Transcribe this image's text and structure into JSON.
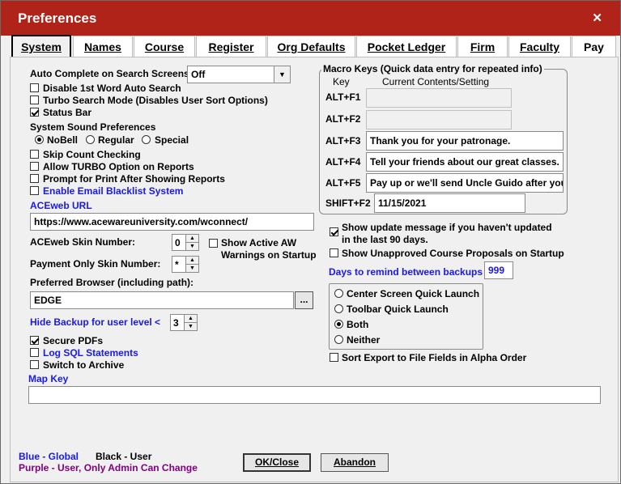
{
  "window": {
    "title": "Preferences",
    "close_label": "✕"
  },
  "tabs": [
    "System",
    "Names",
    "Course",
    "Register",
    "Org Defaults",
    "Pocket Ledger",
    "Firm",
    "Faculty",
    "Pay"
  ],
  "system": {
    "auto_complete_label": "Auto Complete on Search Screens:",
    "auto_complete_value": "Off",
    "disable_first_word": "Disable 1st Word Auto Search",
    "turbo_search": "Turbo Search Mode (Disables User Sort Options)",
    "status_bar": "Status Bar",
    "sound_label": "System Sound Preferences",
    "sound_options": [
      "NoBell",
      "Regular",
      "Special"
    ],
    "sound_selected": "NoBell",
    "skip_count": "Skip Count Checking",
    "allow_turbo": "Allow TURBO Option on Reports",
    "prompt_print": "Prompt for Print After Showing Reports",
    "enable_blacklist": "Enable Email Blacklist System",
    "aceweb_url_label": "ACEweb URL",
    "aceweb_url_value": "https://www.acewareuniversity.com/wconnect/",
    "skin_number_label": "ACEweb Skin Number:",
    "skin_number_value": "0",
    "show_active_warnings_1": "Show Active AW",
    "show_active_warnings_2": "Warnings on Startup",
    "payment_skin_label": "Payment Only Skin Number:",
    "payment_skin_value": "*",
    "browser_label": "Preferred Browser (including path):",
    "browser_value": "EDGE",
    "browse_button": "...",
    "hide_backup_label": "Hide Backup for user level <",
    "hide_backup_value": "3",
    "secure_pdfs": "Secure PDFs",
    "log_sql": "Log SQL Statements",
    "switch_archive": "Switch to Archive",
    "map_key_label": "Map Key",
    "map_key_value": ""
  },
  "macro": {
    "title": "Macro Keys (Quick data entry for repeated info)",
    "col_key": "Key",
    "col_contents": "Current Contents/Setting",
    "rows": [
      {
        "key": "ALT+F1",
        "value": "",
        "disabled": true
      },
      {
        "key": "ALT+F2",
        "value": "",
        "disabled": true
      },
      {
        "key": "ALT+F3",
        "value": "Thank you for your patronage.",
        "disabled": false
      },
      {
        "key": "ALT+F4",
        "value": "Tell your friends about our great classes.",
        "disabled": false
      },
      {
        "key": "ALT+F5",
        "value": "Pay up or we'll send Uncle Guido after you!",
        "disabled": false
      },
      {
        "key": "SHIFT+F2",
        "value": "11/15/2021",
        "disabled": false
      }
    ]
  },
  "right": {
    "show_update_1": "Show update message if you haven't updated",
    "show_update_2": "in the last 90 days.",
    "show_unapproved": "Show Unapproved Course Proposals on Startup",
    "days_backup_label": "Days to remind between backups",
    "days_backup_value": "999",
    "quick_launch_options": [
      "Center Screen Quick Launch",
      "Toolbar Quick Launch",
      "Both",
      "Neither"
    ],
    "quick_launch_selected": "Both",
    "sort_export": "Sort Export to File Fields in Alpha Order"
  },
  "legend": {
    "blue": "Blue - Global",
    "black": "Black - User",
    "purple": "Purple - User, Only Admin Can Change"
  },
  "buttons": {
    "ok": "OK/Close",
    "abandon": "Abandon"
  },
  "colors": {
    "titlebar": "#b02318",
    "global_blue": "#1a1ae6",
    "admin_purple": "#800080"
  }
}
